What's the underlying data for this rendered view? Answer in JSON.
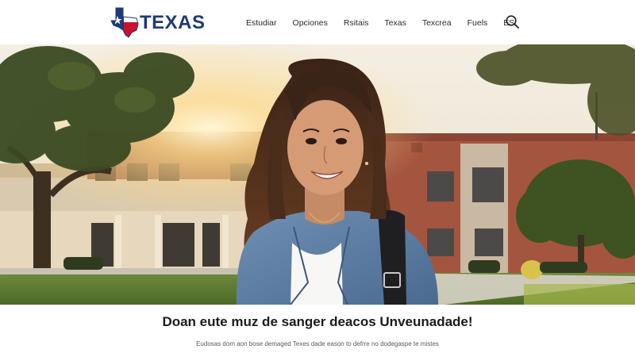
{
  "brand": {
    "name": "TEXAS",
    "logo_icon": "texas-state-flag-icon",
    "colors": {
      "navy": "#1f3a78",
      "red": "#c8102e"
    }
  },
  "nav": {
    "items": [
      {
        "label": "Estudiar"
      },
      {
        "label": "Opciones"
      },
      {
        "label": "Rsitais"
      },
      {
        "label": "Texas"
      },
      {
        "label": "Texcrea"
      },
      {
        "label": "Fuels"
      },
      {
        "label": "ES"
      }
    ],
    "search_icon": "search-icon"
  },
  "hero": {
    "image": "student-smiling-on-campus-at-sunset"
  },
  "content": {
    "headline": "Doan eute muz de sanger deacos Unveunadade!",
    "subtext": "Eudosas dom aon bose demaged Texes dade eason to defrre no dodegaspe te mistes"
  }
}
